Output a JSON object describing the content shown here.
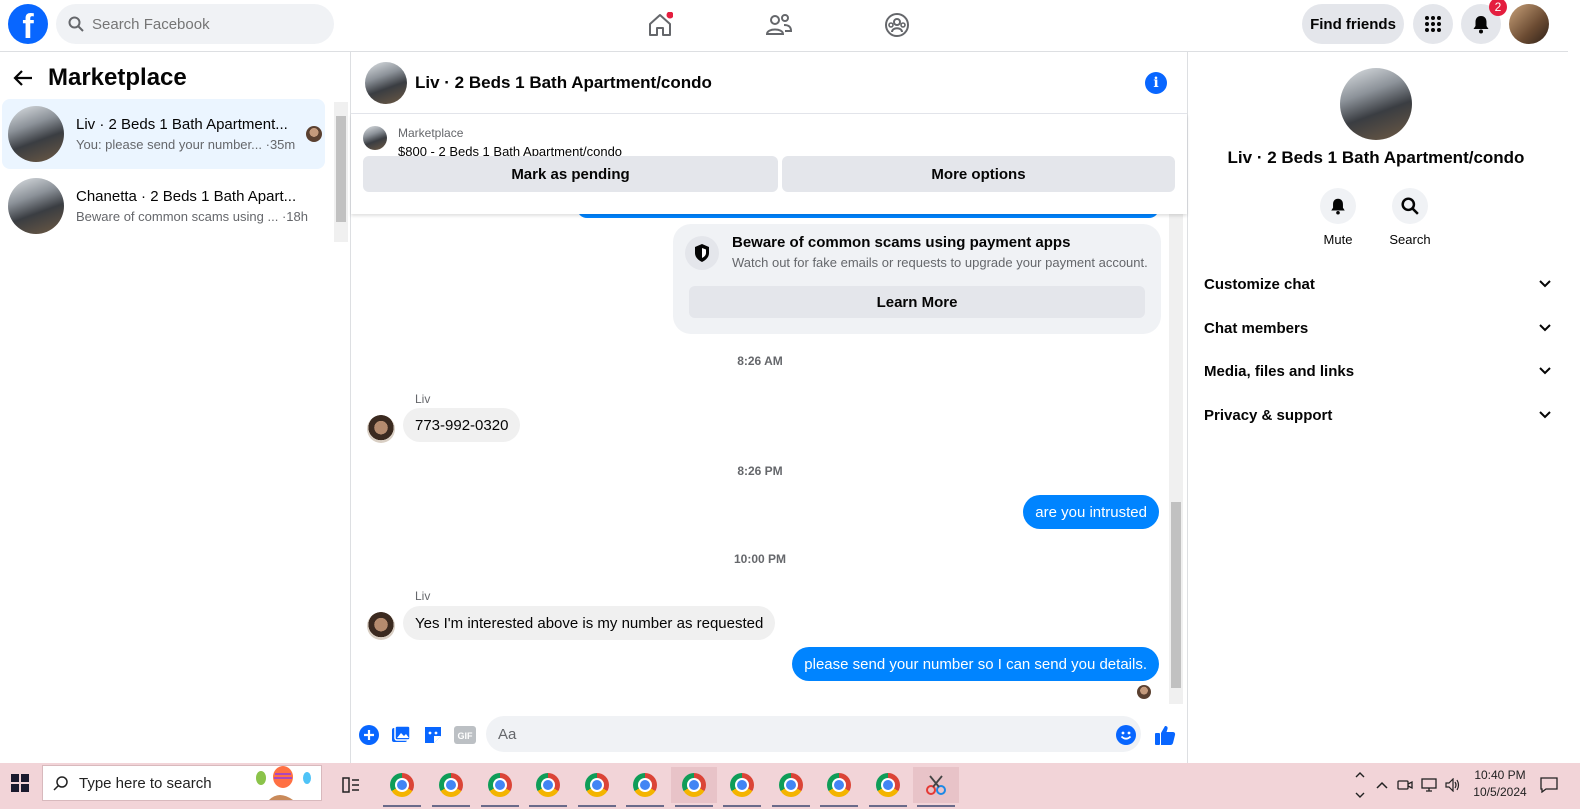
{
  "topbar": {
    "search_placeholder": "Search Facebook",
    "find_friends_label": "Find friends",
    "notification_count": "2"
  },
  "sidebar": {
    "title": "Marketplace",
    "threads": [
      {
        "name": "Liv · 2 Beds 1 Bath Apartment...",
        "preview": "You: please send your number...",
        "time": "·35m",
        "active": true
      },
      {
        "name": "Chanetta · 2 Beds 1 Bath Apart...",
        "preview": "Beware of common scams using ...",
        "time": "·18h",
        "active": false
      }
    ]
  },
  "chat": {
    "title": "Liv · 2 Beds 1 Bath Apartment/condo",
    "listing": {
      "source": "Marketplace",
      "title": "$800 - 2 Beds 1 Bath Apartment/condo",
      "mark_pending_label": "Mark as pending",
      "more_options_label": "More options"
    },
    "scam_card": {
      "title": "Beware of common scams using payment apps",
      "description": "Watch out for fake emails or requests to upgrade your payment account.",
      "button_label": "Learn More"
    },
    "messages": [
      {
        "type": "timestamp",
        "text": "8:26 AM"
      },
      {
        "type": "incoming",
        "sender": "Liv",
        "text": "773-992-0320"
      },
      {
        "type": "timestamp",
        "text": "8:26 PM"
      },
      {
        "type": "outgoing",
        "text": "are you intrusted"
      },
      {
        "type": "timestamp",
        "text": "10:00 PM"
      },
      {
        "type": "incoming",
        "sender": "Liv",
        "text": "Yes I'm interested above is my number as requested"
      },
      {
        "type": "outgoing",
        "text": "please send your number so I can send you details."
      }
    ],
    "composer_placeholder": "Aa"
  },
  "details": {
    "name": "Liv · 2 Beds 1 Bath Apartment/condo",
    "actions": [
      {
        "label": "Mute",
        "icon": "bell-icon"
      },
      {
        "label": "Search",
        "icon": "search-icon"
      }
    ],
    "sections": [
      "Customize chat",
      "Chat members",
      "Media, files and links",
      "Privacy & support"
    ]
  },
  "taskbar": {
    "search_placeholder": "Type here to search",
    "time": "10:40 PM",
    "date": "10/5/2024"
  },
  "colors": {
    "brand": "#0866ff",
    "outgoing_bubble": "#0084ff",
    "incoming_bubble": "#f0f0f0",
    "notification_badge": "#e41e3f",
    "taskbar": "#f2d4d8"
  }
}
